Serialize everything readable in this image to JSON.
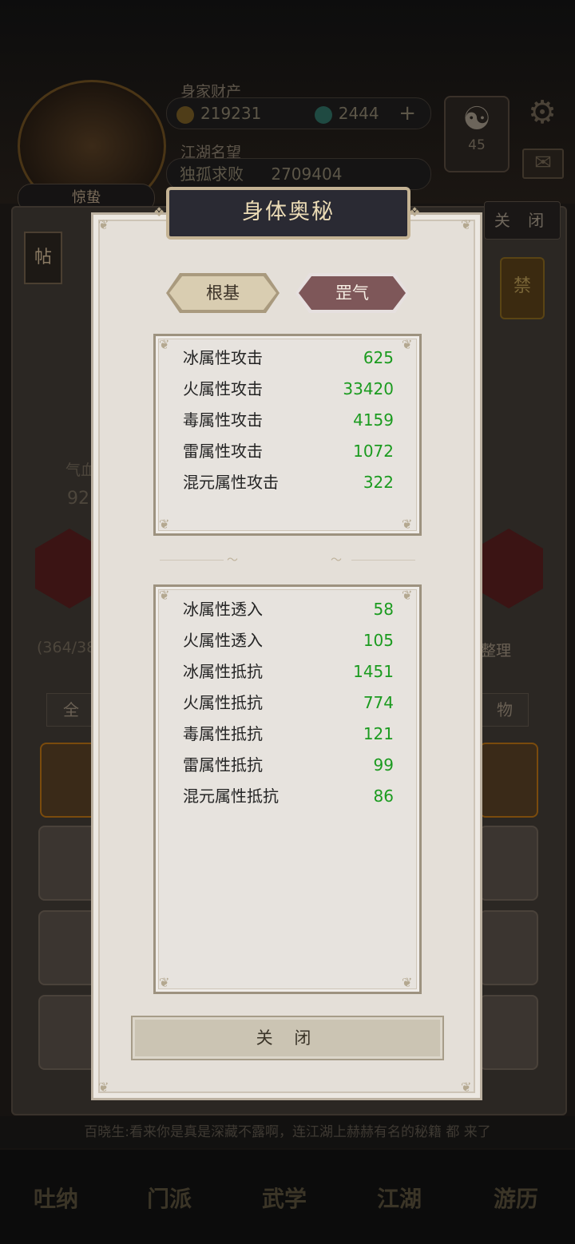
{
  "background": {
    "wealth_label": "身家财产",
    "coins": "219231",
    "gems": "2444",
    "reputation_label": "江湖名望",
    "rank_title": "独孤求败",
    "reputation_value": "2709404",
    "player_name": "惊蛰",
    "emblem_level": "45",
    "close_label": "关 闭",
    "tie_label": "帖",
    "side_stat_label": "气血",
    "side_stat_value": "92",
    "bag_count": "(364/38",
    "sort_label": "整理",
    "tab_all": "全",
    "tab_item": "物",
    "marquee_text": "百晓生:看来你是真是深藏不露啊，连江湖上赫赫有名的秘籍 都 来了",
    "nav": [
      "吐纳",
      "门派",
      "武学",
      "江湖",
      "游历"
    ]
  },
  "dialog": {
    "title": "身体奥秘",
    "tabs": [
      "根基",
      "罡气"
    ],
    "active_tab": "罡气",
    "attack_stats": [
      {
        "name": "冰属性攻击",
        "value": "625"
      },
      {
        "name": "火属性攻击",
        "value": "33420"
      },
      {
        "name": "毒属性攻击",
        "value": "4159"
      },
      {
        "name": "雷属性攻击",
        "value": "1072"
      },
      {
        "name": "混元属性攻击",
        "value": "322"
      }
    ],
    "resist_stats": [
      {
        "name": "冰属性透入",
        "value": "58"
      },
      {
        "name": "火属性透入",
        "value": "105"
      },
      {
        "name": "冰属性抵抗",
        "value": "1451"
      },
      {
        "name": "火属性抵抗",
        "value": "774"
      },
      {
        "name": "毒属性抵抗",
        "value": "121"
      },
      {
        "name": "雷属性抵抗",
        "value": "99"
      },
      {
        "name": "混元属性抵抗",
        "value": "86"
      }
    ],
    "close_label": "关 闭",
    "value_color": "#1b9b1f"
  }
}
